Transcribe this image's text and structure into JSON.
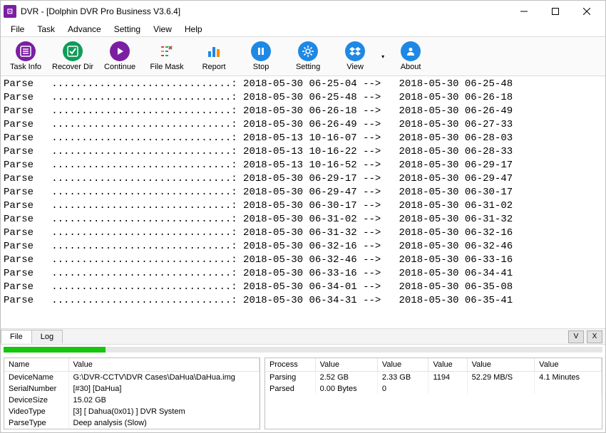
{
  "titlebar": {
    "icon_text": "⊡",
    "title": "DVR - [Dolphin DVR Pro Business V3.6.4]"
  },
  "menu": [
    "File",
    "Task",
    "Advance",
    "Setting",
    "View",
    "Help"
  ],
  "toolbar": [
    {
      "name": "task-info",
      "label": "Task Info",
      "color": "#7b1fa2",
      "glyph": "list"
    },
    {
      "name": "recover-dir",
      "label": "Recover Dir",
      "color": "#0f9d58",
      "glyph": "check"
    },
    {
      "name": "continue",
      "label": "Continue",
      "color": "#7b1fa2",
      "glyph": "play"
    },
    {
      "name": "file-mask",
      "label": "File Mask",
      "color": "#multi",
      "glyph": "mask"
    },
    {
      "name": "report",
      "label": "Report",
      "color": "#1e88e5",
      "glyph": "bars"
    },
    {
      "name": "stop",
      "label": "Stop",
      "color": "#1e88e5",
      "glyph": "pause"
    },
    {
      "name": "setting",
      "label": "Setting",
      "color": "#1e88e5",
      "glyph": "gear"
    },
    {
      "name": "view",
      "label": "View",
      "color": "#1e88e5",
      "glyph": "dropbox",
      "caret": true
    },
    {
      "name": "about",
      "label": "About",
      "color": "#1e88e5",
      "glyph": "person"
    }
  ],
  "log": [
    [
      "Parse",
      "2018-05-30 06-25-04",
      "2018-05-30 06-25-48"
    ],
    [
      "Parse",
      "2018-05-30 06-25-48",
      "2018-05-30 06-26-18"
    ],
    [
      "Parse",
      "2018-05-30 06-26-18",
      "2018-05-30 06-26-49"
    ],
    [
      "Parse",
      "2018-05-30 06-26-49",
      "2018-05-30 06-27-33"
    ],
    [
      "Parse",
      "2018-05-13 10-16-07",
      "2018-05-30 06-28-03"
    ],
    [
      "Parse",
      "2018-05-13 10-16-22",
      "2018-05-30 06-28-33"
    ],
    [
      "Parse",
      "2018-05-13 10-16-52",
      "2018-05-30 06-29-17"
    ],
    [
      "Parse",
      "2018-05-30 06-29-17",
      "2018-05-30 06-29-47"
    ],
    [
      "Parse",
      "2018-05-30 06-29-47",
      "2018-05-30 06-30-17"
    ],
    [
      "Parse",
      "2018-05-30 06-30-17",
      "2018-05-30 06-31-02"
    ],
    [
      "Parse",
      "2018-05-30 06-31-02",
      "2018-05-30 06-31-32"
    ],
    [
      "Parse",
      "2018-05-30 06-31-32",
      "2018-05-30 06-32-16"
    ],
    [
      "Parse",
      "2018-05-30 06-32-16",
      "2018-05-30 06-32-46"
    ],
    [
      "Parse",
      "2018-05-30 06-32-46",
      "2018-05-30 06-33-16"
    ],
    [
      "Parse",
      "2018-05-30 06-33-16",
      "2018-05-30 06-34-41"
    ],
    [
      "Parse",
      "2018-05-30 06-34-01",
      "2018-05-30 06-35-08"
    ],
    [
      "Parse",
      "2018-05-30 06-34-31",
      "2018-05-30 06-35-41"
    ]
  ],
  "dots": "..............................",
  "arrow": "-->",
  "tabs": {
    "file": "File",
    "log": "Log",
    "v": "V",
    "x": "X"
  },
  "left_panel": {
    "headers": [
      "Name",
      "Value"
    ],
    "rows": [
      [
        "DeviceName",
        "G:\\DVR-CCTV\\DVR Cases\\DaHua\\DaHua.img"
      ],
      [
        "SerialNumber",
        "[#30]  [DaHua]"
      ],
      [
        "DeviceSize",
        "15.02 GB"
      ],
      [
        "VideoType",
        "[3]  [ Dahua(0x01) ] DVR System"
      ],
      [
        "ParseType",
        "Deep analysis (Slow)"
      ]
    ]
  },
  "right_panel": {
    "headers": [
      "Process",
      "Value",
      "Value",
      "Value",
      "Value",
      "Value"
    ],
    "rows": [
      [
        "Parsing",
        "2.52 GB",
        "2.33 GB",
        "1194",
        "52.29 MB/S",
        "4.1 Minutes"
      ],
      [
        "Parsed",
        "0.00 Bytes",
        "0",
        "",
        "",
        ""
      ]
    ]
  }
}
